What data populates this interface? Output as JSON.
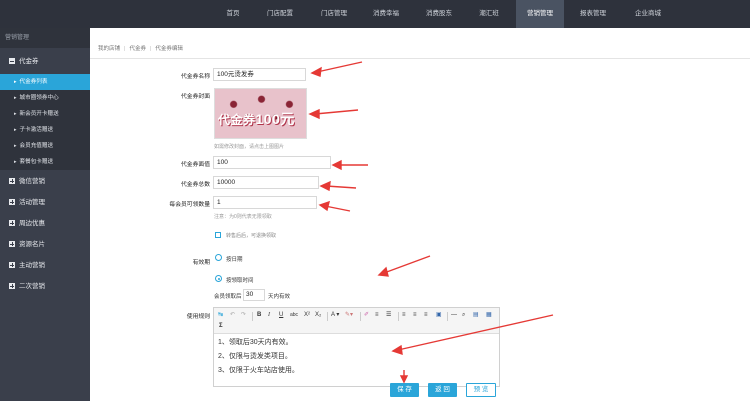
{
  "topnav": {
    "items": [
      "首页",
      "门店配置",
      "门店管理",
      "消费幸福",
      "消费股东",
      "潮汇班",
      "营销管理",
      "报表管理",
      "企业商城"
    ],
    "active_index": 6
  },
  "sidebar": {
    "header": "营销管理",
    "groups": [
      "代金券",
      "微信营销",
      "活动管理",
      "周边优惠",
      "资源名片",
      "主动营销",
      "二次营销"
    ],
    "subs": [
      "代金券列表",
      "城市圈领券中心",
      "新会员开卡赠送",
      "子卡激活赠送",
      "会员充值赠送",
      "套餐包卡赠送"
    ],
    "active_sub": 0
  },
  "breadcrumb": [
    "我的店铺",
    "代金券",
    "代金券编辑"
  ],
  "form": {
    "name_label": "代金券名称",
    "name_value": "100元烫发券",
    "cover_label": "代金券封面",
    "cover_text": "代金券",
    "cover_num": "100元",
    "cover_hint": "如需修改封面，请点击上图图片",
    "value_label": "代金券面值",
    "value_value": "100",
    "total_label": "代金券总数",
    "total_value": "10000",
    "limit_label": "每会员可领数量",
    "limit_value": "1",
    "limit_hint": "注意：为0则代表无限领取",
    "share_text": "转售后后，可退换领取",
    "validity_label": "有效期",
    "validity_opt1": "按日期",
    "validity_opt2": "按领取时间",
    "days_prefix": "会员领取后",
    "days_value": "30",
    "days_suffix": "天内有效",
    "rules_label": "使用规则",
    "rules_lines": [
      "1、领取后30天内有效。",
      "2、仅限与烫发类项目。",
      "3、仅限于火车站店使用。"
    ]
  },
  "buttons": {
    "save": "保 存",
    "back": "返 回",
    "preview": "预 览"
  },
  "colors": {
    "accent": "#2aa5d9",
    "nav_bg": "#2e323c",
    "sidebar_bg": "#3a3f4b",
    "arrow": "#e53935"
  }
}
